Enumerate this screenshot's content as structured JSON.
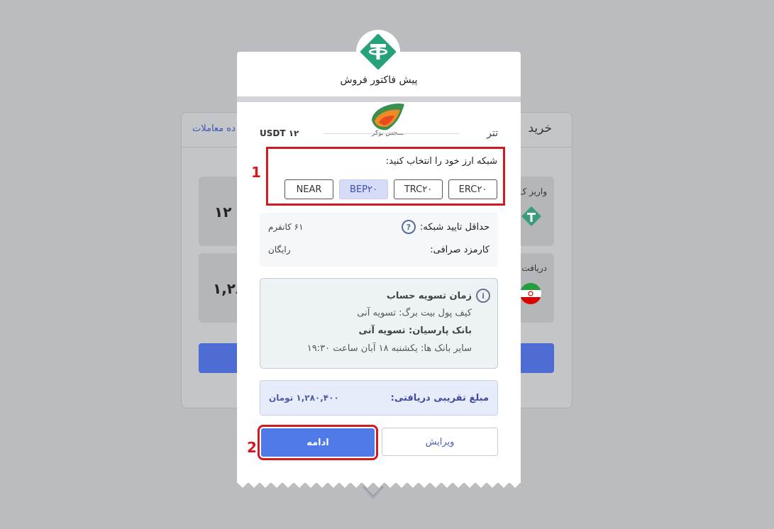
{
  "background": {
    "tab_buy": "خرید",
    "tab_history": "ده معاملات",
    "box1_label": "واریز ک",
    "box1_value": "۱۲",
    "box2_label": "دریافت",
    "box2_value": "۱,۲۸"
  },
  "modal": {
    "title": "پیش فاکتور فروش",
    "watermark": "ـــجس یوکر",
    "asset_name": "تتر",
    "asset_amount": "USDT ۱۲",
    "network_prompt": "شبکه ارز خود را انتخاب کنید:",
    "networks": [
      {
        "label": "ERC۲۰",
        "active": false
      },
      {
        "label": "TRC۲۰",
        "active": false
      },
      {
        "label": "BEP۲۰",
        "active": true
      },
      {
        "label": "NEAR",
        "active": false
      }
    ],
    "min_confirm_label": "حداقل تایید شبکه:",
    "min_confirm_value": "۶۱ کانفرم",
    "fee_label": "کارمزد صرافی:",
    "fee_value": "رایگان",
    "settlement": {
      "title": "زمان تسویه حساب",
      "line1": "کیف پول بیت برگ: تسویه آنی",
      "line2": "بانک پارسیان: تسویه آنی",
      "line3": "سایر بانک ها: یکشنبه ۱۸ آبان ساعت ۱۹:۳۰"
    },
    "amount_label": "مبلغ تقریبی دریافتی:",
    "amount_value": "۱,۲۸۰,۴۰۰ تومان",
    "continue_label": "ادامه",
    "edit_label": "ویرایش"
  },
  "annotations": {
    "badge1": "1",
    "badge2": "2"
  },
  "colors": {
    "highlight": "#d11a22",
    "primary": "#4f7ae8",
    "tether": "#26a17b"
  }
}
